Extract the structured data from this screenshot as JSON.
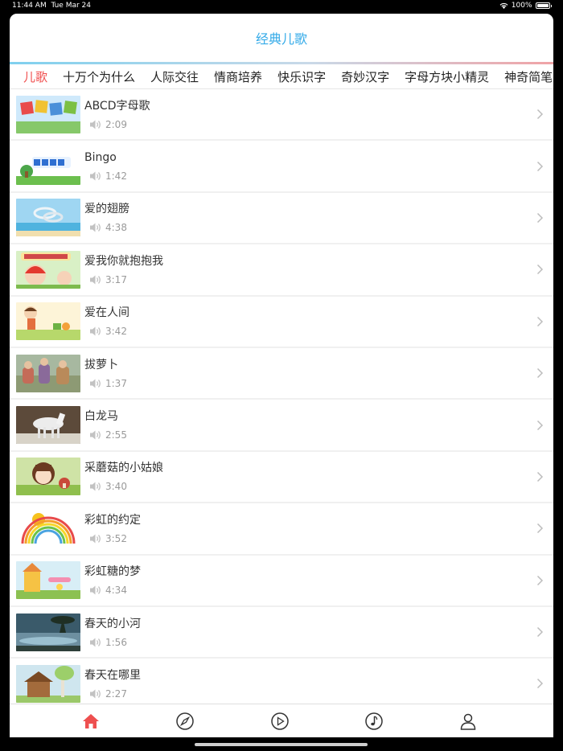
{
  "status": {
    "time": "11:44 AM",
    "date": "Tue Mar 24",
    "battery": "100%"
  },
  "nav": {
    "title": "经典儿歌"
  },
  "tabs": [
    "儿歌",
    "十万个为什么",
    "人际交往",
    "情商培养",
    "快乐识字",
    "奇妙汉字",
    "字母方块小精灵",
    "神奇简笔画"
  ],
  "active_tab": 0,
  "songs": [
    {
      "title": "ABCD字母歌",
      "duration": "2:09"
    },
    {
      "title": "Bingo",
      "duration": "1:42"
    },
    {
      "title": "爱的翅膀",
      "duration": "4:38"
    },
    {
      "title": "爱我你就抱抱我",
      "duration": "3:17"
    },
    {
      "title": "爱在人间",
      "duration": "3:42"
    },
    {
      "title": "拔萝卜",
      "duration": "1:37"
    },
    {
      "title": "白龙马",
      "duration": "2:55"
    },
    {
      "title": "采蘑菇的小姑娘",
      "duration": "3:40"
    },
    {
      "title": "彩虹的约定",
      "duration": "3:52"
    },
    {
      "title": "彩虹糖的梦",
      "duration": "4:34"
    },
    {
      "title": "春天的小河",
      "duration": "1:56"
    },
    {
      "title": "春天在哪里",
      "duration": "2:27"
    }
  ],
  "tabbar": [
    "home-icon",
    "compass-icon",
    "play-circle-icon",
    "music-note-icon",
    "person-icon"
  ],
  "colors": {
    "accent_blue": "#33aae8",
    "active_red": "#f04f4f",
    "home_red": "#ee4f4f"
  }
}
